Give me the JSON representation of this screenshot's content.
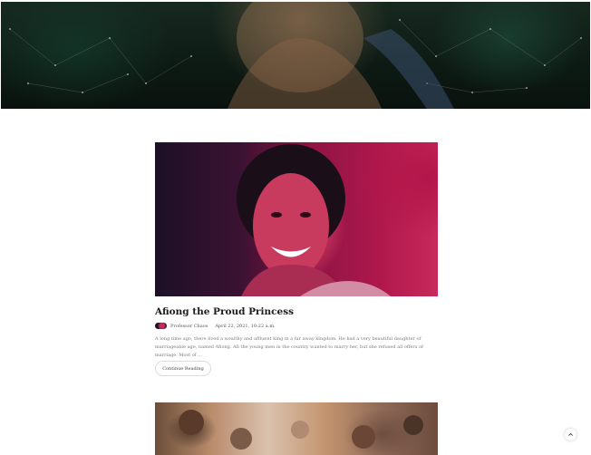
{
  "post": {
    "title": "Afiong the Proud Princess",
    "author": "Professor Chaos",
    "date": "April 22, 2021, 10:22 a.m.",
    "excerpt": "A long time ago, there lived a wealthy and affluent king in a far away kingdom. He had a very beautiful daughter of marriageable age, named Afiong. All the young men in the country wanted to marry her, but she refused all offers of marriage. Most of …",
    "continue_label": "Continue Reading"
  },
  "icons": {
    "scroll_top": "chevron-up-icon"
  },
  "colors": {
    "hero_dark_green": "#0d1a14",
    "feature_red": "#c2305a",
    "button_border": "#dcdcdc"
  }
}
